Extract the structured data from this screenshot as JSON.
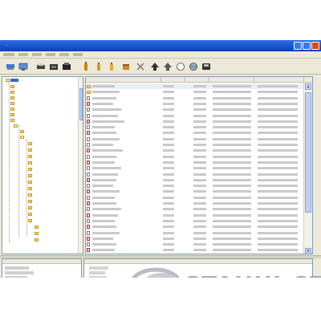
{
  "window": {
    "title": "..."
  },
  "watermark": {
    "text": "STAHUJ.CZ"
  },
  "colors": {
    "titlebar": "#0a3fb8",
    "selection": "#316ac5",
    "folder": "#f5d06a",
    "window_bg": "#ece9d8"
  },
  "toolbar": {
    "icons": [
      "network-icon",
      "monitor-icon",
      "printer-icon",
      "folder-icon",
      "box-icon",
      "bottle-icon",
      "bottle-icon",
      "bottle-icon",
      "box-icon",
      "tools-icon",
      "arrow-up-icon",
      "arrow-up-icon",
      "circle-icon",
      "globe-icon",
      "disk-icon"
    ]
  }
}
